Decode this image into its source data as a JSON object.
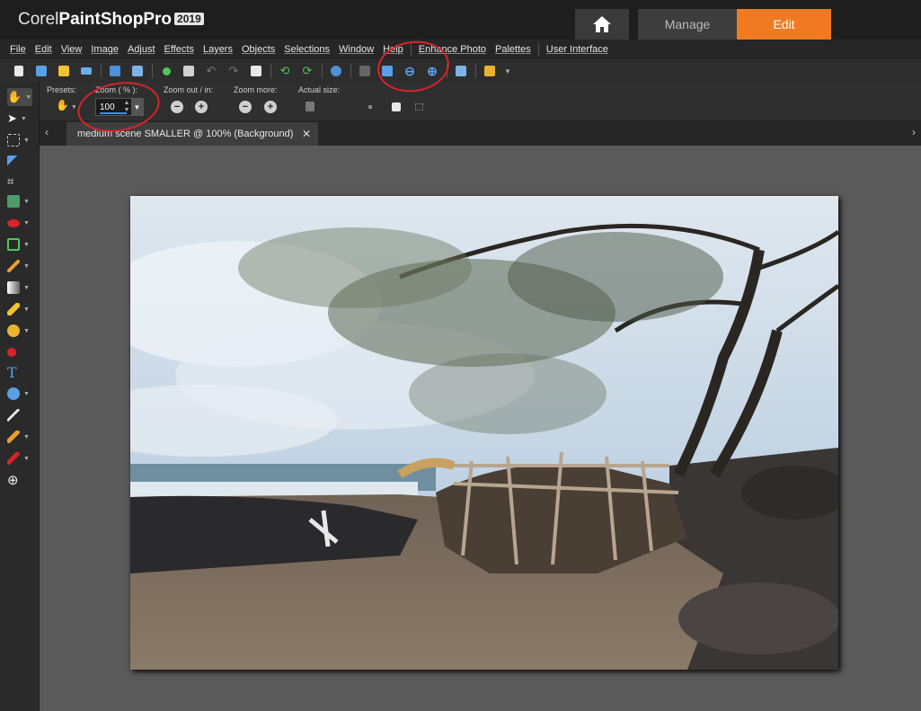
{
  "app": {
    "brand_prefix": "Corel",
    "brand_name": "PaintShop",
    "brand_suffix": "Pro",
    "year": "2019"
  },
  "workspace_tabs": {
    "manage": "Manage",
    "edit": "Edit",
    "active": "Edit",
    "active_color": "#f07a21"
  },
  "menu": [
    "File",
    "Edit",
    "View",
    "Image",
    "Adjust",
    "Effects",
    "Layers",
    "Objects",
    "Selections",
    "Window",
    "Help",
    "Enhance Photo",
    "Palettes",
    "User Interface"
  ],
  "tool_options": {
    "presets_label": "Presets:",
    "zoom_label": "Zoom ( % ):",
    "zoom_value": "100",
    "zoom_out_in_label": "Zoom out / in:",
    "zoom_more_label": "Zoom more:",
    "actual_size_label": "Actual size:"
  },
  "document": {
    "tab_title": "medium scene SMALLER @ 100% (Background)"
  },
  "toolbar_icons": [
    "new-icon",
    "browse-icon",
    "open-icon",
    "scan-icon",
    "save-icon",
    "save-as-icon",
    "share-icon",
    "print-icon",
    "undo-icon",
    "redo-icon",
    "resize-icon",
    "rotate-left-icon",
    "rotate-right-icon",
    "info-icon",
    "grid-icon",
    "zoom-fit-icon",
    "zoom-out-icon",
    "zoom-in-icon",
    "fit-window-icon",
    "layers-icon"
  ],
  "tools": [
    "pan-tool-icon",
    "pick-tool-icon",
    "selection-tool-icon",
    "dropper-tool-icon",
    "crop-tool-icon",
    "straighten-tool-icon",
    "red-eye-tool-icon",
    "clone-tool-icon",
    "paint-brush-tool-icon",
    "gradient-tool-icon",
    "eraser-tool-icon",
    "paint-bucket-tool-icon",
    "color-dot-tool-icon",
    "text-tool-icon",
    "shape-tool-icon",
    "pen-tool-icon",
    "retouch-tool-icon",
    "lighten-tool-icon",
    "add-tool-icon"
  ],
  "colors": {
    "accent": "#f07a21",
    "annotation": "#d9232a"
  }
}
